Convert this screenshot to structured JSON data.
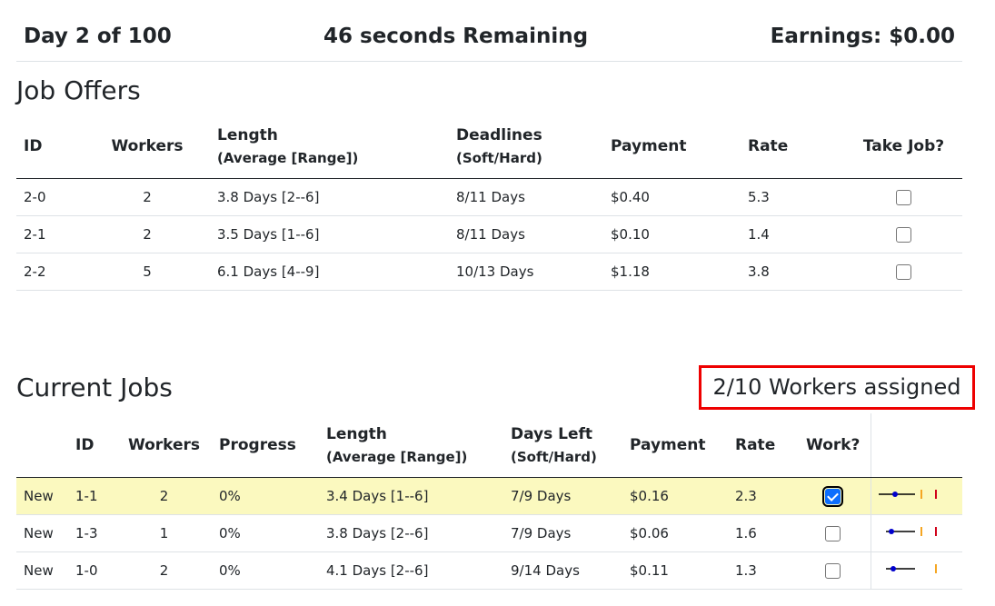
{
  "header": {
    "day": "Day 2 of 100",
    "timer": "46 seconds Remaining",
    "earnings": "Earnings: $0.00"
  },
  "offers": {
    "title": "Job Offers",
    "columns": {
      "id": "ID",
      "workers": "Workers",
      "length": "Length",
      "length_sub": "(Average [Range])",
      "deadlines": "Deadlines",
      "deadlines_sub": "(Soft/Hard)",
      "payment": "Payment",
      "rate": "Rate",
      "take": "Take Job?"
    },
    "rows": [
      {
        "id": "2-0",
        "workers": "2",
        "length": "3.8 Days [2--6]",
        "deadlines": "8/11 Days",
        "payment": "$0.40",
        "rate": "5.3",
        "checked": false
      },
      {
        "id": "2-1",
        "workers": "2",
        "length": "3.5 Days [1--6]",
        "deadlines": "8/11 Days",
        "payment": "$0.10",
        "rate": "1.4",
        "checked": false
      },
      {
        "id": "2-2",
        "workers": "5",
        "length": "6.1 Days [4--9]",
        "deadlines": "10/13 Days",
        "payment": "$1.18",
        "rate": "3.8",
        "checked": false
      }
    ]
  },
  "current": {
    "title": "Current Jobs",
    "assigned": "2/10 Workers assigned",
    "columns": {
      "id": "ID",
      "workers": "Workers",
      "progress": "Progress",
      "length": "Length",
      "length_sub": "(Average [Range])",
      "days_left": "Days Left",
      "days_left_sub": "(Soft/Hard)",
      "payment": "Payment",
      "rate": "Rate",
      "work": "Work?"
    },
    "rows": [
      {
        "status": "New",
        "id": "1-1",
        "workers": "2",
        "progress": "0%",
        "length": "3.4 Days [1--6]",
        "days_left": "7/9 Days",
        "payment": "$0.16",
        "rate": "2.3",
        "checked": true
      },
      {
        "status": "New",
        "id": "1-3",
        "workers": "1",
        "progress": "0%",
        "length": "3.8 Days [2--6]",
        "days_left": "7/9 Days",
        "payment": "$0.06",
        "rate": "1.6",
        "checked": false
      },
      {
        "status": "New",
        "id": "1-0",
        "workers": "2",
        "progress": "0%",
        "length": "4.1 Days [2--6]",
        "days_left": "9/14 Days",
        "payment": "$0.11",
        "rate": "1.3",
        "checked": false
      }
    ]
  },
  "colors": {
    "highlight_row": "#fbf9bf",
    "assigned_border": "#ee0000",
    "soft_deadline": "#f5a623",
    "hard_deadline": "#d0021b",
    "progress_dot": "#0000cc"
  }
}
